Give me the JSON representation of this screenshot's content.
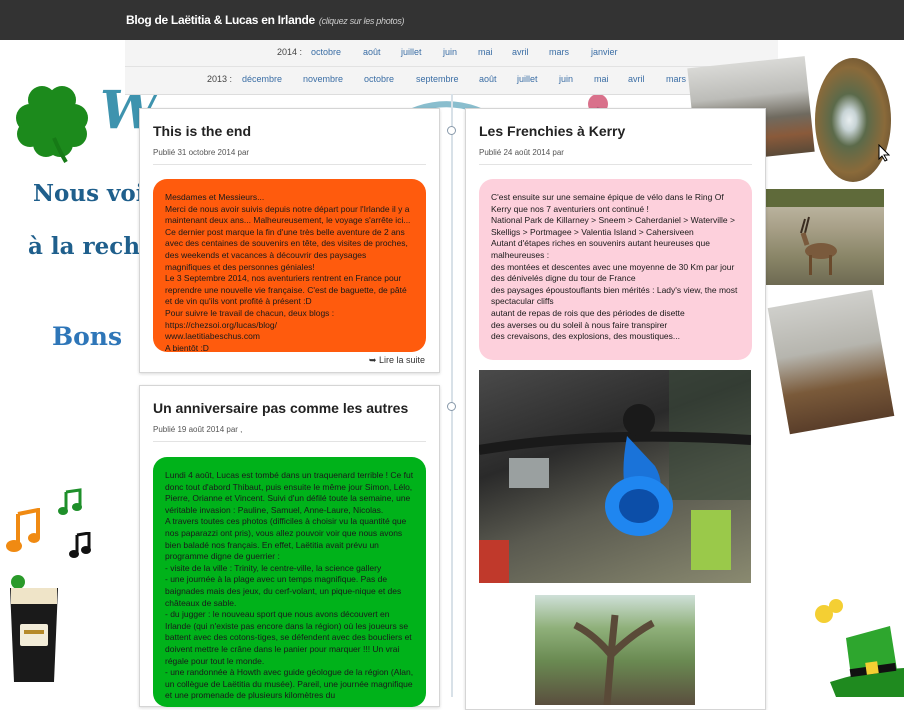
{
  "header": {
    "title": "Blog de Laëtitia & Lucas en Irlande",
    "subtitle": "(cliquez sur les photos)"
  },
  "archive": {
    "year_2014": "2014 :",
    "months_2014": [
      "octobre",
      "août",
      "juillet",
      "juin",
      "mai",
      "avril",
      "mars",
      "janvier"
    ],
    "year_2013": "2013 :",
    "months_2013": [
      "décembre",
      "novembre",
      "octobre",
      "septembre",
      "août",
      "juillet",
      "juin",
      "mai",
      "avril",
      "mars"
    ]
  },
  "banner": {
    "line1": "Nous voic",
    "line2": "à la recher",
    "line3": "Bons"
  },
  "posts": [
    {
      "title": "This is the end",
      "meta": "Publié 31 octobre 2014 par",
      "bubble_color": "#ff5b0d",
      "lines": [
        "Mesdames et Messieurs...",
        "Merci de nous avoir suivis depuis notre départ pour l'Irlande il y a maintenant deux ans... Malheureusement, le voyage s'arrête ici... Ce dernier post marque la fin d'une très belle aventure de 2 ans avec des centaines de souvenirs en tête, des visites de proches, des weekends et vacances à découvrir des paysages magnifiques et des personnes géniales!",
        "Le 3 Septembre 2014, nos aventuriers rentrent en France pour reprendre une nouvelle vie française. C'est de baguette, de pâté et de vin qu'ils vont profité à présent :D",
        "Pour suivre le travail de chacun, deux blogs :",
        "https://chezsoi.org/lucas/blog/",
        "www.laetitiabeschus.com",
        "A bientôt :D"
      ],
      "read_more": "➥ Lire la suite"
    },
    {
      "title": "Un anniversaire pas comme les autres",
      "meta": "Publié 19 août 2014 par ,",
      "bubble_color": "#00b21a",
      "lines": [
        "Lundi 4 août, Lucas est tombé dans un traquenard terrible ! Ce fut donc tout d'abord Thibaut, puis ensuite le même jour Simon, Lélo, Pierre, Orianne et Vincent. Suivi d'un défilé toute la semaine, une véritable invasion : Pauline, Samuel, Anne-Laure, Nicolas.",
        "A travers toutes ces photos (difficiles à choisir vu la quantité que nos paparazzi ont pris), vous allez pouvoir voir que nous avons bien baladé nos français. En effet, Laëtitia avait prévu un programme digne de guerrier :",
        "- visite de la ville : Trinity, le centre-ville, la science gallery",
        "- une journée à la plage avec un temps magnifique. Pas de baignades mais des jeux, du cerf-volant, un pique-nique et des châteaux de sable.",
        "- du jugger : le nouveau sport que nous avons découvert en Irlande (qui n'existe pas encore dans la région) où les joueurs se battent avec des cotons-tiges, se défendent avec des boucliers et doivent mettre le crâne dans le panier pour marquer !!! Un vrai régale pour tout le monde.",
        "- une randonnée à Howth avec guide géologue de la région (Alan, un collègue de Laëtitia du musée). Pareil, une journée magnifique et une promenade de plusieurs kilomètres du"
      ]
    },
    {
      "title": "Les Frenchies à Kerry",
      "meta": "Publié 24 août 2014 par",
      "bubble_color": "#fdd0dc",
      "lines": [
        "C'est ensuite sur une semaine épique de vélo dans le Ring Of Kerry que nos 7 aventuriers ont continué !",
        "National Park de Killarney > Sneem > Caherdaniel > Waterville > Skelligs > Portmagee > Valentia Island > Cahersiveen",
        "Autant d'étapes riches en souvenirs autant heureuses que malheureuses :",
        "des montées et descentes avec une moyenne de 30 Km par jour",
        "des dénivelés digne du tour de France",
        "des paysages époustouflants bien mérités : Lady's view, the most spectacular cliffs",
        "autant de repas de rois que des périodes de disette",
        "des averses ou du soleil à nous faire transpirer",
        "des crevaisons, des explosions, des moustiques..."
      ]
    }
  ],
  "icons": [
    "shamrock-icon",
    "music-note-icon",
    "guinness-glass-icon",
    "leprechaun-hat-icon",
    "cursor-icon"
  ]
}
